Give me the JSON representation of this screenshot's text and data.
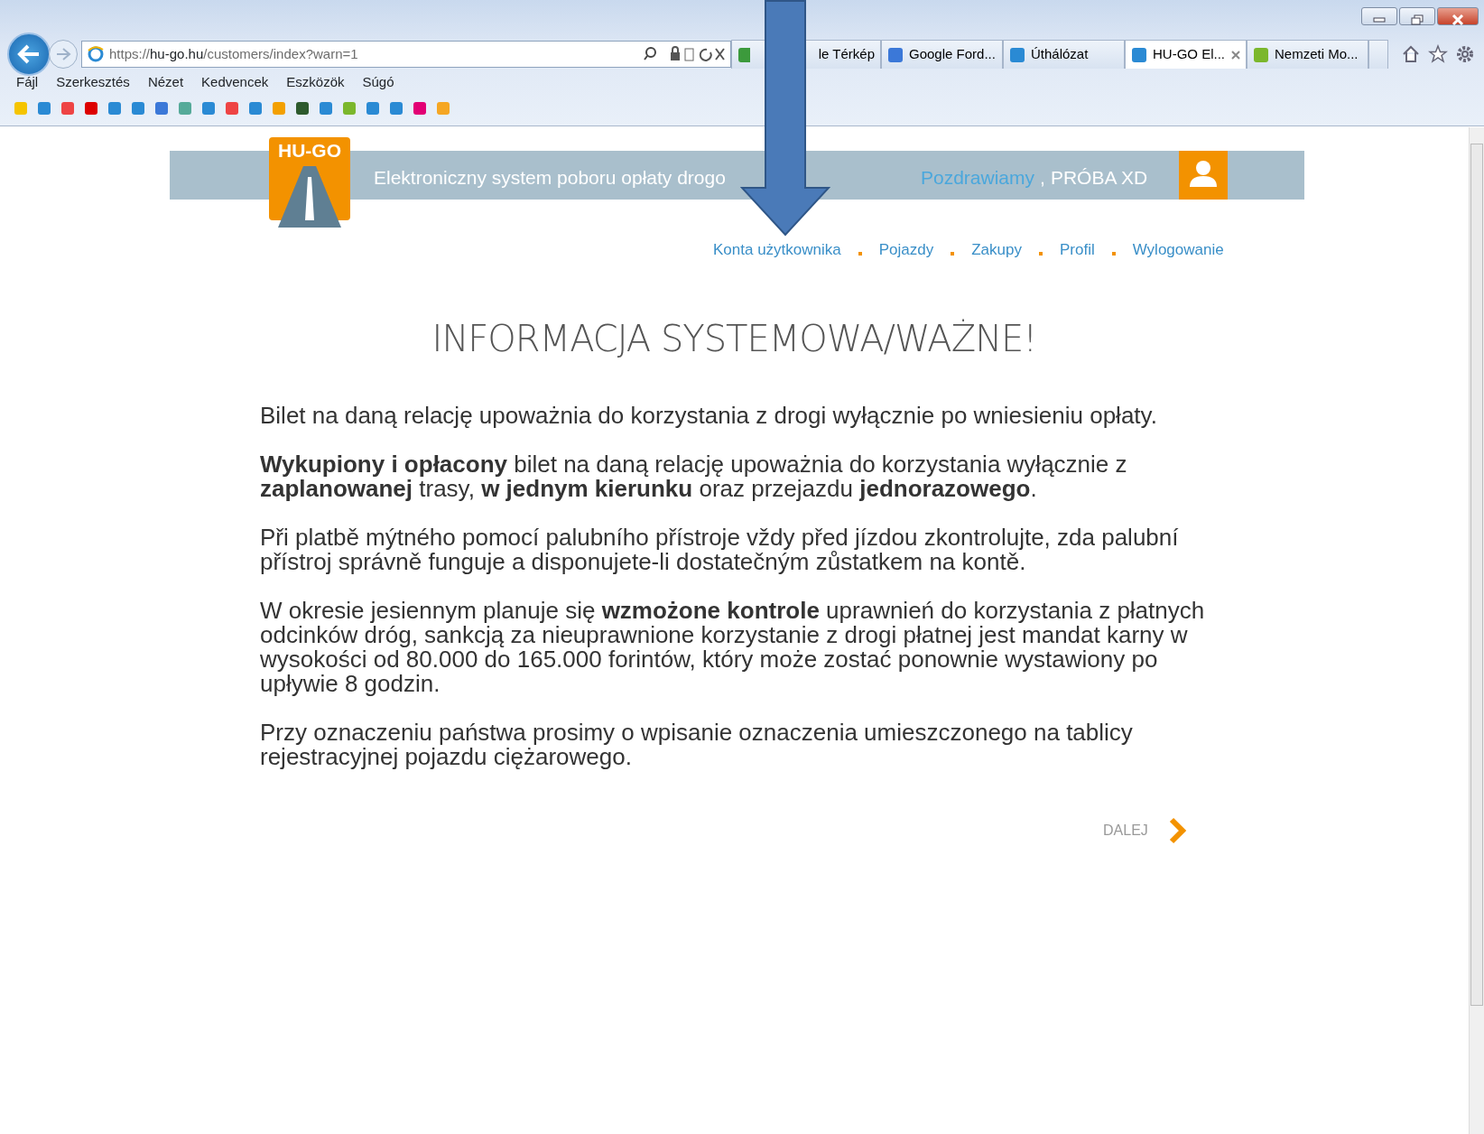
{
  "browser": {
    "address": {
      "scheme": "https://",
      "host": "hu-go.hu",
      "path": "/customers/index?warn=1"
    },
    "tabs": [
      {
        "label": "le Térkép",
        "selected": false
      },
      {
        "label": "Google Ford...",
        "selected": false
      },
      {
        "label": "Úthálózat",
        "selected": false
      },
      {
        "label": "HU-GO El...",
        "selected": true
      },
      {
        "label": "Nemzeti Mo...",
        "selected": false
      }
    ],
    "menu": [
      "Fájl",
      "Szerkesztés",
      "Nézet",
      "Kedvencek",
      "Eszközök",
      "Súgó"
    ]
  },
  "header": {
    "logo": "HU-GO",
    "tagline": "Elektroniczny system poboru opłaty drogo",
    "greeting": "Pozdrawiamy",
    "separator": ",",
    "user": "PRÓBA XD"
  },
  "nav": [
    "Konta użytkownika",
    "Pojazdy",
    "Zakupy",
    "Profil",
    "Wylogowanie"
  ],
  "title": "INFORMACJA SYSTEMOWA/WAŻNE!",
  "paragraphs": [
    "Bilet na daną relację upoważnia do korzystania z drogi wyłącznie po wniesieniu opłaty.",
    "**Wykupiony i opłacony** bilet na daną relację upoważnia do korzystania wyłącznie z **zaplanowanej** trasy, **w jednym kierunku** oraz przejazdu **jednorazowego**.",
    "Při platbě mýtného pomocí palubního přístroje vždy před jízdou zkontrolujte, zda palubní přístroj správně funguje a disponujete-li dostatečným zůstatkem na kontě.",
    "W okresie jesiennym planuje się **wzmożone kontrole** uprawnień do korzystania z płatnych odcinków dróg, sankcją za nieuprawnione korzystanie z drogi płatnej jest mandat karny w wysokości od 80.000 do 165.000 forintów, który może zostać ponownie wystawiony po upływie 8 godzin.",
    "Przy oznaczeniu państwa prosimy o wpisanie oznaczenia umieszczonego na tablicy rejestracyjnej pojazdu ciężarowego."
  ],
  "next_button": "DALEJ"
}
